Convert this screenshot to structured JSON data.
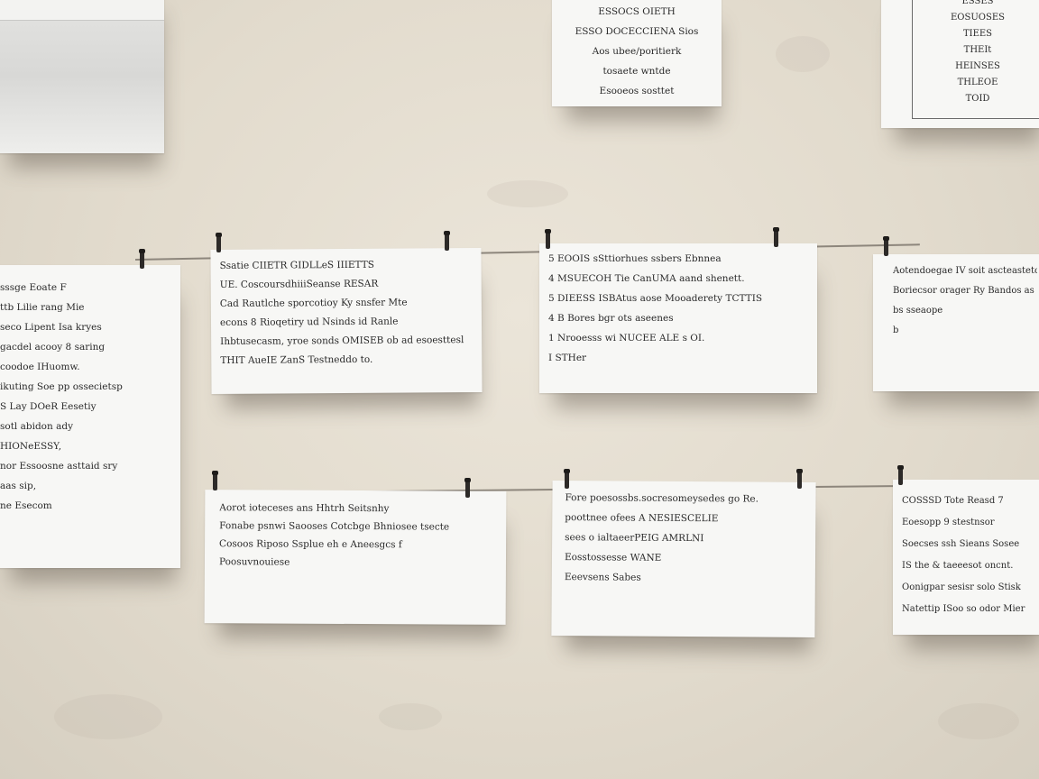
{
  "papers": {
    "top_left": {
      "lines": [
        "",
        "",
        "",
        ""
      ]
    },
    "top_center": {
      "lines": [
        "ESSOCS OIETH",
        "ESSO DOCECCIENA Sios",
        "Aos ubee/poritierk",
        "tosaete wntde",
        "Esooeos sosttet"
      ]
    },
    "top_right": {
      "lines": [
        "ESSES",
        "EOSUOSES",
        "TIEES",
        "THEIt",
        "HEINSES",
        "THLEOE",
        "TOID"
      ]
    },
    "row1_left": {
      "lines": [
        "sssge Eoate F",
        "ttb Lilie rang Mie",
        "seco Lipent Isa kryes",
        "gacdel acooy 8 saring",
        "coodoe IHuomw.",
        "ikuting Soe pp ossecietsp",
        "S Lay DOeR Eesetiy",
        "sotl abidon ady",
        "HIONeESSY,",
        "nor Essoosne asttaid sry",
        "aas sip,",
        "ne Esecom"
      ]
    },
    "row1_b": {
      "lines": [
        "Ssatie CIIETR GIDLLeS IIIETTS",
        "UE. CoscoursdhiiiSeanse RESAR",
        "Cad Rautlche sporcotioy Ky snsfer Mte",
        "econs 8 Rioqetiry ud Nsinds id Ranle",
        "Ihbtusecasm, yroe sonds OMISEB ob ad esoesttesl",
        "THIT AueIE ZanS Testneddo to."
      ]
    },
    "row1_c": {
      "lines": [
        "5  EOOIS sSttiorhues ssbers Ebnnea",
        "4  MSUECOH Tie CanUMA aand shenett.",
        "5  DIEESS ISBAtus aose Mooaderety TCTTIS",
        "4  B Bores bgr   ots aseenes",
        "1  Nrooesss wi  NUCEE ALE s OI.",
        "I  STHer"
      ]
    },
    "row1_right": {
      "lines": [
        "Aotendoegae IV soit ascteasteto",
        "Boriecsor orager Ry Bandos as sugeest",
        "bs sseaope",
        "b"
      ]
    },
    "row2_b": {
      "lines": [
        "Aorot ioteceses ans Hhtrh Seitsnhy",
        "Fonabe psnwi Saooses Cotcbge Bhniosee tsecte",
        "Cosoos Riposo Ssplue eh e Aneesgcs f",
        "Poosuvnouiese"
      ]
    },
    "row2_c": {
      "lines": [
        "Fore poesossbs.socresomeysedes go Re.",
        "poottnee ofees A  NESIESCELIE",
        "sees  o ialtaeerPEIG AMRLNI",
        "Eosstossesse WANE",
        "Eeevsens Sabes"
      ]
    },
    "row2_right": {
      "lines": [
        "COSSSD Tote Reasd 7",
        "Eoesopp 9 stestnsor",
        "Soecses ssh Sieans Sosee",
        "IS the & taeeesot oncnt.",
        "Oonigpar sesisr solo Stisk",
        "Natettip ISoo so odor Mier"
      ]
    }
  }
}
